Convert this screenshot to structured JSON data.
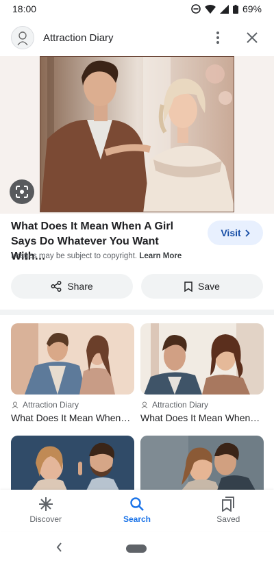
{
  "status": {
    "time": "18:00",
    "battery": "69%"
  },
  "header": {
    "site_name": "Attraction Diary"
  },
  "result": {
    "title": "What Does It Mean When A Girl Says Do Whatever You Want With…",
    "visit_label": "Visit",
    "copyright_text": "Images may be subject to copyright.",
    "learn_more": "Learn More"
  },
  "actions": {
    "share_label": "Share",
    "save_label": "Save"
  },
  "related": [
    {
      "source": "Attraction Diary",
      "title": "What Does It Mean When…"
    },
    {
      "source": "Attraction Diary",
      "title": "What Does It Mean When…"
    }
  ],
  "nav": [
    {
      "label": "Discover",
      "icon": "asterisk-icon"
    },
    {
      "label": "Search",
      "icon": "search-icon"
    },
    {
      "label": "Saved",
      "icon": "bookmark-icon"
    }
  ],
  "colors": {
    "accent": "#1a73e8",
    "visit_bg": "#e8f0fe",
    "pill_bg": "#f1f3f4"
  }
}
